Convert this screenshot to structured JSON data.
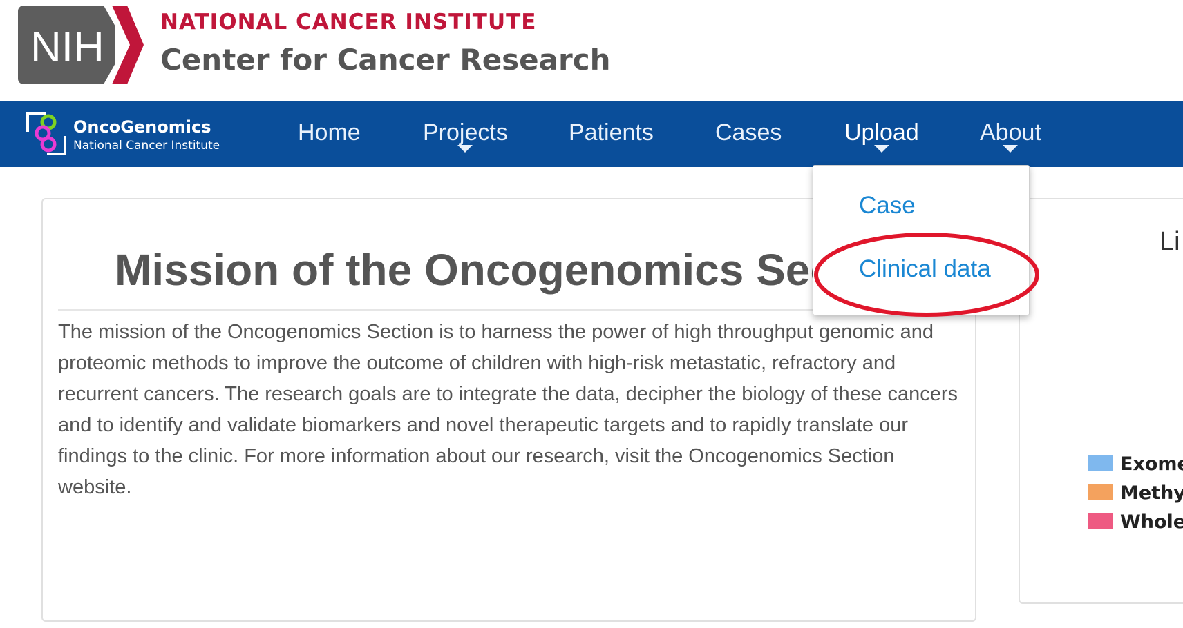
{
  "header": {
    "nih_logo_text": "NIH",
    "institute": "NATIONAL CANCER INSTITUTE",
    "center": "Center for Cancer Research",
    "colors": {
      "institute": "#c0163a",
      "logo_gray": "#5d5d5d",
      "logo_red": "#c0163a"
    }
  },
  "navbar": {
    "brand_name": "OncoGenomics",
    "brand_sub": "National Cancer Institute",
    "items": [
      {
        "label": "Home",
        "has_dropdown": false
      },
      {
        "label": "Projects",
        "has_dropdown": true
      },
      {
        "label": "Patients",
        "has_dropdown": false
      },
      {
        "label": "Cases",
        "has_dropdown": false
      },
      {
        "label": "Upload",
        "has_dropdown": true,
        "open": true
      },
      {
        "label": "About",
        "has_dropdown": true
      }
    ],
    "background": "#0a4e9a",
    "icon": "caret-down-icon"
  },
  "dropdown": {
    "items": [
      {
        "label": "Case"
      },
      {
        "label": "Clinical data",
        "highlighted": true
      }
    ],
    "link_color": "#1a87d3",
    "highlight_color": "#e0162b"
  },
  "mission": {
    "title": "Mission of the Oncogenomics Section",
    "body": "The mission of the Oncogenomics Section is to harness the power of high throughput genomic and proteomic methods to improve the outcome of children with high-risk metastatic, refractory and recurrent cancers. The research goals are to integrate the data, decipher the biology of these cancers and to identify and validate biomarkers and novel therapeutic targets and to rapidly translate our findings to the clinic. For more information about our research, visit the Oncogenomics Section website."
  },
  "chart_panel": {
    "title_visible": "Li",
    "legend": [
      {
        "label": "Exome",
        "color": "#7fb8ee"
      },
      {
        "label": "Methyla",
        "color": "#f4a25e"
      },
      {
        "label": "Whole G",
        "color": "#ee5a82"
      }
    ]
  }
}
